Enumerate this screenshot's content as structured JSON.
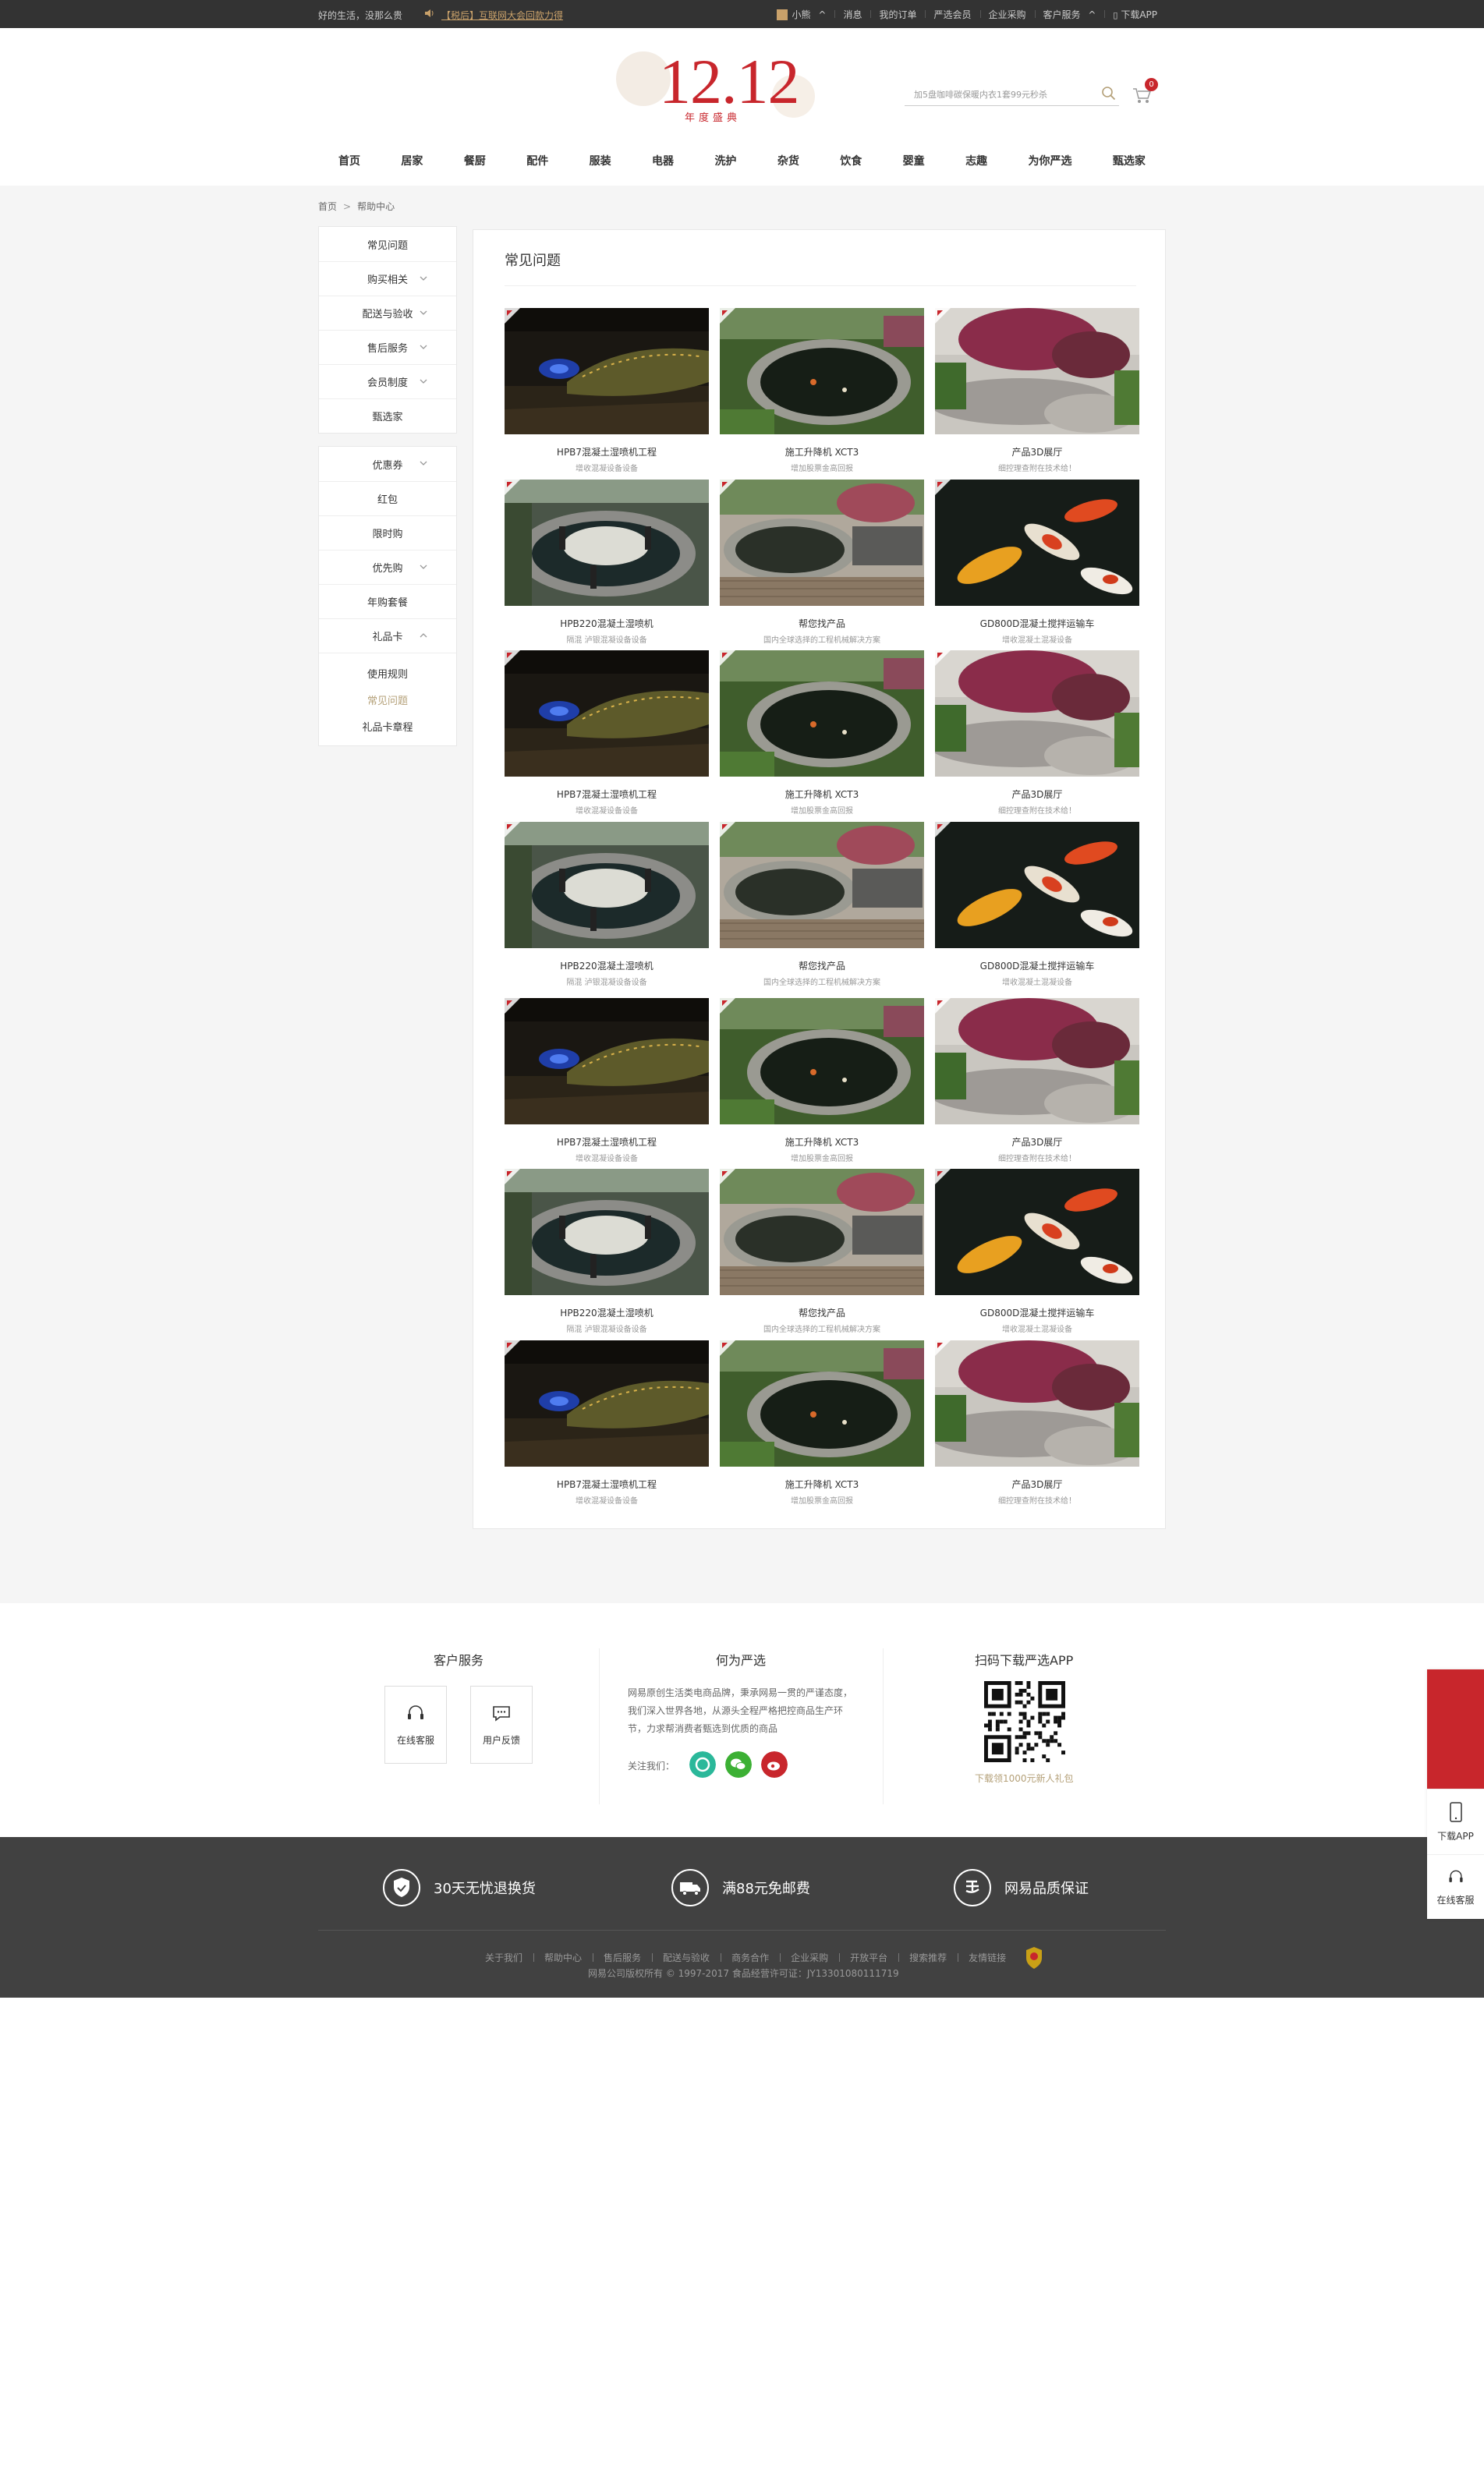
{
  "topbar": {
    "slogan": "好的生活，没那么贵",
    "notice": "【税后】互联网大会回款力得",
    "links": [
      "小熊",
      "消息",
      "我的订单",
      "严选会员",
      "企业采购",
      "客户服务",
      "下载APP"
    ]
  },
  "header": {
    "logo_big": "12.12",
    "logo_sub": "年度盛典",
    "search_placeholder": "加5盘咖啡碳保暖内衣1套99元秒杀",
    "cart_count": "0",
    "nav": [
      "首页",
      "居家",
      "餐厨",
      "配件",
      "服装",
      "电器",
      "洗护",
      "杂货",
      "饮食",
      "婴童",
      "志趣",
      "为你严选",
      "甄选家"
    ]
  },
  "breadcrumb": {
    "home": "首页",
    "sep": ">",
    "current": "帮助中心"
  },
  "sidebar": {
    "group1": [
      {
        "label": "常见问题",
        "chevron": false
      },
      {
        "label": "购买相关",
        "chevron": true
      },
      {
        "label": "配送与验收",
        "chevron": true
      },
      {
        "label": "售后服务",
        "chevron": true
      },
      {
        "label": "会员制度",
        "chevron": true
      },
      {
        "label": "甄选家",
        "chevron": false
      }
    ],
    "group2": [
      {
        "label": "优惠券",
        "chevron": true
      },
      {
        "label": "红包",
        "chevron": false
      },
      {
        "label": "限时购",
        "chevron": false
      },
      {
        "label": "优先购",
        "chevron": true
      },
      {
        "label": "年购套餐",
        "chevron": false
      },
      {
        "label": "礼品卡",
        "chevron": true,
        "open": true
      }
    ],
    "sub": [
      {
        "label": "使用规则",
        "active": false
      },
      {
        "label": "常见问题",
        "active": true
      },
      {
        "label": "礼品卡章程",
        "active": false
      }
    ]
  },
  "content": {
    "title": "常见问题",
    "cards": [
      {
        "title": "HPB7混凝土湿喷机工程",
        "sub": "增收混凝设备设备",
        "photo": "night-pool"
      },
      {
        "title": "施工升降机 XCT3",
        "sub": "增加股票金高回报",
        "photo": "koi-pond"
      },
      {
        "title": "产品3D展厅",
        "sub": "细控理查附在技术给！",
        "photo": "maple-garden"
      },
      {
        "title": "HPB220混凝土湿喷机",
        "sub": "隔混 泸银混凝设备设备",
        "photo": "patio-dining"
      },
      {
        "title": "帮您找产品",
        "sub": "国内全球选择的工程机械解决方案",
        "photo": "deck-pond"
      },
      {
        "title": "GD800D混凝土搅拌运输车",
        "sub": "增收混凝土混凝设备",
        "photo": "koi-fish"
      },
      {
        "title": "HPB7混凝土湿喷机工程",
        "sub": "增收混凝设备设备",
        "photo": "night-pool"
      },
      {
        "title": "施工升降机 XCT3",
        "sub": "增加股票金高回报",
        "photo": "koi-pond"
      },
      {
        "title": "产品3D展厅",
        "sub": "细控理查附在技术给！",
        "photo": "maple-garden"
      },
      {
        "title": "HPB220混凝土湿喷机",
        "sub": "隔混 泸银混凝设备设备",
        "photo": "patio-dining"
      },
      {
        "title": "帮您找产品",
        "sub": "国内全球选择的工程机械解决方案",
        "photo": "deck-pond"
      },
      {
        "title": "GD800D混凝土搅拌运输车",
        "sub": "增收混凝土混凝设备",
        "photo": "koi-fish"
      },
      {
        "title": "HPB7混凝土湿喷机工程",
        "sub": "增收混凝设备设备",
        "photo": "night-pool"
      },
      {
        "title": "施工升降机 XCT3",
        "sub": "增加股票金高回报",
        "photo": "koi-pond"
      },
      {
        "title": "产品3D展厅",
        "sub": "细控理查附在技术给！",
        "photo": "maple-garden"
      },
      {
        "title": "HPB220混凝土湿喷机",
        "sub": "隔混 泸银混凝设备设备",
        "photo": "patio-dining"
      },
      {
        "title": "帮您找产品",
        "sub": "国内全球选择的工程机械解决方案",
        "photo": "deck-pond"
      },
      {
        "title": "GD800D混凝土搅拌运输车",
        "sub": "增收混凝土混凝设备",
        "photo": "koi-fish"
      },
      {
        "title": "HPB7混凝土湿喷机工程",
        "sub": "增收混凝设备设备",
        "photo": "night-pool"
      },
      {
        "title": "施工升降机 XCT3",
        "sub": "增加股票金高回报",
        "photo": "koi-pond"
      },
      {
        "title": "产品3D展厅",
        "sub": "细控理查附在技术给！",
        "photo": "maple-garden"
      }
    ]
  },
  "footer": {
    "service_title": "客户服务",
    "online_service": "在线客服",
    "feedback": "用户反馈",
    "about_title": "何为严选",
    "about_text": "网易原创生活类电商品牌，秉承网易一贯的严谨态度，我们深入世界各地，从源头全程严格把控商品生产环节，力求帮消费者甄选到优质的商品",
    "follow_label": "关注我们：",
    "app_title": "扫码下载严选APP",
    "app_caption": "下载领1000元新人礼包"
  },
  "promises": [
    "30天无忧退换货",
    "满88元免邮费",
    "网易品质保证"
  ],
  "footer_links": [
    "关于我们",
    "帮助中心",
    "售后服务",
    "配送与验收",
    "商务合作",
    "企业采购",
    "开放平台",
    "搜索推荐",
    "友情链接"
  ],
  "copyright": "网易公司版权所有 © 1997-2017   食品经营许可证：JY13301080111719",
  "float_bar": {
    "download": "下载APP",
    "service": "在线客服"
  },
  "colors": {
    "accent_red": "#c8262c",
    "gold": "#b4a078",
    "dark": "#414141"
  }
}
